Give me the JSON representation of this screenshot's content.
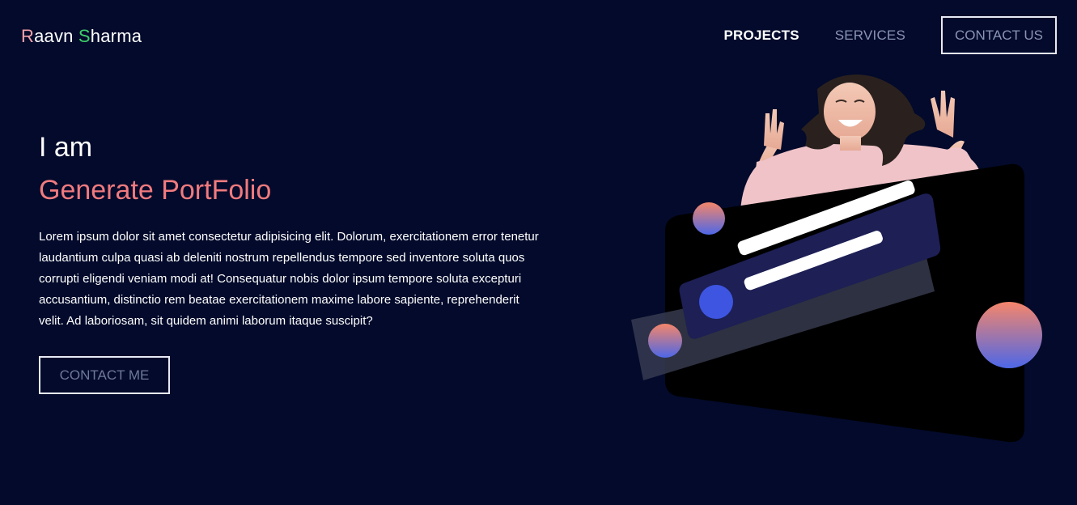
{
  "header": {
    "logo": {
      "first_initial": "R",
      "first_rest": "aavn ",
      "last_initial": "S",
      "last_rest": "harma"
    },
    "nav": {
      "projects": "PROJECTS",
      "services": "SERVICES",
      "contact": "CONTACT US"
    }
  },
  "hero": {
    "intro": "I am",
    "title": "Generate PortFolio",
    "body": "Lorem ipsum dolor sit amet consectetur adipisicing elit. Dolorum, exercitationem error tenetur laudantium culpa quasi ab deleniti nostrum repellendus tempore sed inventore soluta quos corrupti eligendi veniam modi at! Consequatur nobis dolor ipsum tempore soluta excepturi accusantium, distinctio rem beatae exercitationem maxime labore sapiente, reprehenderit velit. Ad laboriosam, sit quidem animi laborum itaque suscipit?",
    "button": "CONTACT ME"
  },
  "colors": {
    "background": "#030a2b",
    "accent_red": "#f07a7e",
    "accent_green": "#3ecf6a",
    "logo_pink": "#f5a3ac",
    "card_navy": "#1d1f55",
    "bubble_blue": "#3d55e0"
  },
  "illustration": {
    "icon": "laughing-woman-card-illustration"
  }
}
